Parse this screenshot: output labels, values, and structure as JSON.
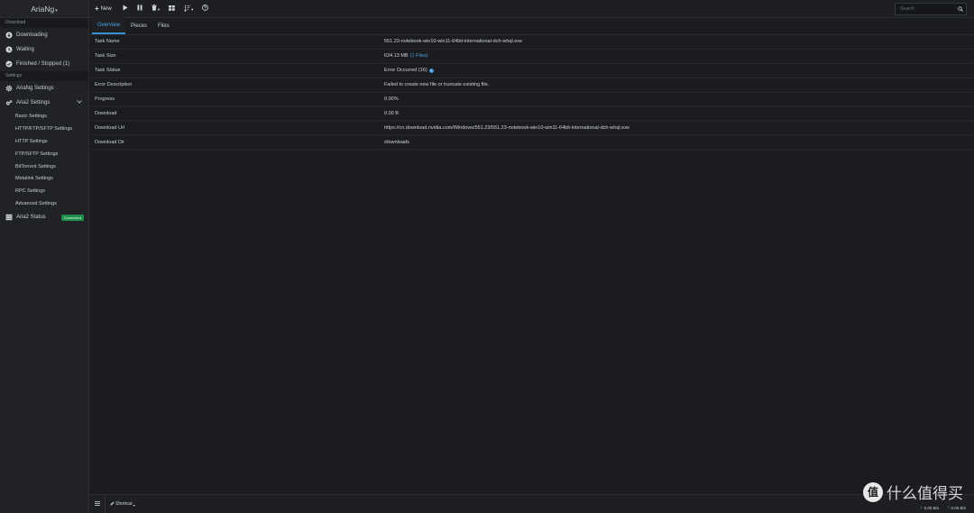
{
  "app": {
    "title": "AriaNg"
  },
  "sidebar": {
    "download_section": "Download",
    "download_items": [
      {
        "label": "Downloading",
        "icon": "circle-arrow-down-icon"
      },
      {
        "label": "Waiting",
        "icon": "clock-icon"
      },
      {
        "label": "Finished / Stopped (1)",
        "icon": "check-circle-icon"
      }
    ],
    "settings_section": "Settings",
    "ariang_settings": "AriaNg Settings",
    "aria2_settings": "Aria2 Settings",
    "aria2_sub": [
      "Basic Settings",
      "HTTP/FTP/SFTP Settings",
      "HTTP Settings",
      "FTP/SFTP Settings",
      "BitTorrent Settings",
      "Metalink Settings",
      "RPC Settings",
      "Advanced Settings"
    ],
    "aria2_status": "Aria2 Status",
    "status_badge": "Connected"
  },
  "toolbar": {
    "new_label": "New",
    "search_placeholder": "Search"
  },
  "tabs": [
    "Overview",
    "Pieces",
    "Files"
  ],
  "details": {
    "task_name_label": "Task Name",
    "task_name": "551.23-notebook-win10-win11-64bit-international-dch-whql.exe",
    "task_size_label": "Task Size",
    "task_size": "634.13 MB",
    "task_size_files": "(1 Files)",
    "task_status_label": "Task Status",
    "task_status": "Error Occurred (16)",
    "error_desc_label": "Error Description",
    "error_desc": "Failed to create new file or truncate existing file.",
    "progress_label": "Progress",
    "progress": "0.00%",
    "download_label": "Download",
    "download": "0.00 B",
    "download_url_label": "Download Url",
    "download_url": "https://cn.download.nvidia.com/Windows/551.23/551.23-notebook-win10-win11-64bit-international-dch-whql.exe",
    "download_dir_label": "Download Dir",
    "download_dir": "/downloads"
  },
  "footer": {
    "shortcut": "Shortcut",
    "down_speed": "0.00 B/s",
    "up_speed": "0.00 B/s"
  },
  "watermark": {
    "text": "什么值得买",
    "logo_char": "值"
  },
  "colors": {
    "accent": "#3b8fd0",
    "badge": "#1c8f4a",
    "bg": "#1b1c1f"
  }
}
